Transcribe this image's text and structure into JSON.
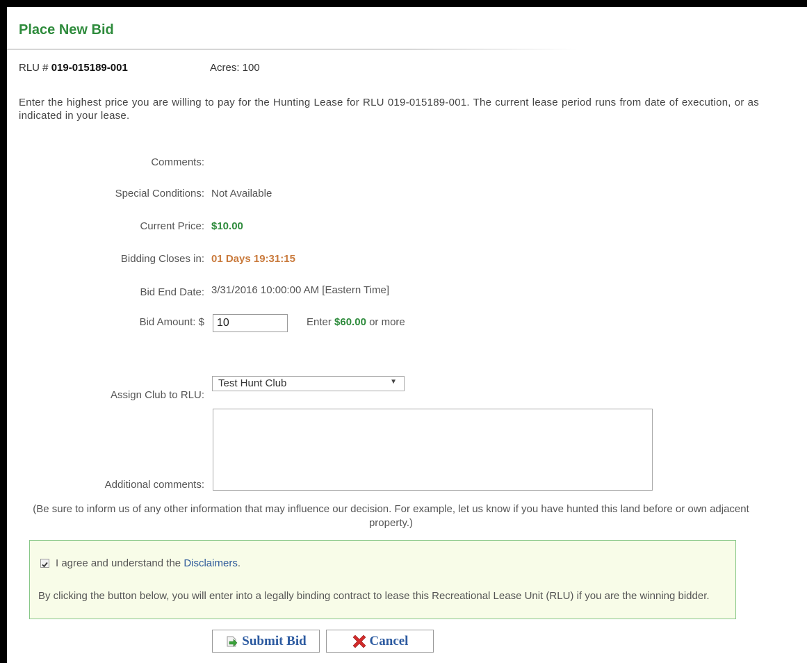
{
  "header": {
    "title": "Place New Bid"
  },
  "rlu": {
    "label": "RLU # ",
    "number": "019-015189-001",
    "acres": "Acres: 100"
  },
  "intro": "Enter the highest price you are willing to pay for the Hunting Lease for RLU 019-015189-001. The current lease period runs from date of execution, or as indicated in your lease.",
  "fields": {
    "comments_label": "Comments:",
    "special_label": "Special Conditions:",
    "special_value": "Not Available",
    "price_label": "Current Price:",
    "price_value": "$10.00",
    "closes_label": "Bidding Closes in:",
    "closes_value": "01 Days 19:31:15",
    "end_label": "Bid End Date:",
    "end_value": "3/31/2016 10:00:00 AM [Eastern Time]",
    "amount_label": "Bid Amount: $",
    "amount_value": "10",
    "min_prefix": "Enter",
    "min_value": "$60.00",
    "min_suffix": "or more",
    "club_label": "Assign Club to RLU:",
    "club_selected": "Test Hunt Club",
    "additional_label": "Additional comments:",
    "additional_value": ""
  },
  "hint": "(Be sure to inform us of any other information that may influence our decision. For example, let us know if you have hunted this land before or own adjacent property.)",
  "agreement": {
    "checked": true,
    "text_prefix": "I agree and understand the",
    "link": "Disclaimers",
    "text_suffix": ".",
    "legal": "By clicking the button below, you will enter into a legally binding contract to lease this Recreational Lease Unit (RLU) if you are the winning bidder."
  },
  "buttons": {
    "submit": "Submit Bid",
    "cancel": "Cancel"
  },
  "icons": {
    "submit": "arrow-right-icon",
    "cancel": "x-icon"
  },
  "colors": {
    "title": "#2e8b3c",
    "price": "#2e8b3c",
    "countdown": "#c97a3c",
    "link": "#2c5aa0",
    "box_bg": "#f8fce8",
    "box_border": "#88c788"
  }
}
